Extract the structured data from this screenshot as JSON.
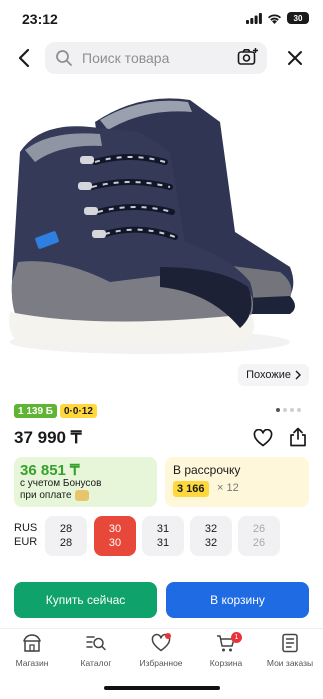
{
  "status_bar": {
    "time": "23:12",
    "battery": "30"
  },
  "search": {
    "placeholder": "Поиск товара"
  },
  "similar": {
    "label": "Похожие"
  },
  "badges": {
    "bonus": "1 139 Б",
    "installment": "0·0·12"
  },
  "price": {
    "current": "37 990 ₸"
  },
  "bonus_card": {
    "price": "36 851 ₸",
    "line1": "с учетом Бонусов",
    "line2": "при оплате"
  },
  "installment_card": {
    "title": "В рассрочку",
    "amount": "3 166",
    "times": "× 12"
  },
  "sizes": {
    "row_labels": [
      "RUS",
      "EUR"
    ],
    "items": [
      {
        "rus": "28",
        "eur": "28",
        "state": "available"
      },
      {
        "rus": "30",
        "eur": "30",
        "state": "selected"
      },
      {
        "rus": "31",
        "eur": "31",
        "state": "available"
      },
      {
        "rus": "32",
        "eur": "32",
        "state": "available"
      },
      {
        "rus": "26",
        "eur": "26",
        "state": "disabled"
      }
    ]
  },
  "actions": {
    "buy_now": "Купить сейчас",
    "add_to_cart": "В корзину"
  },
  "tabs": [
    {
      "label": "Магазин",
      "icon": "shop-icon"
    },
    {
      "label": "Каталог",
      "icon": "catalog-search-icon"
    },
    {
      "label": "Избранное",
      "icon": "heart-icon"
    },
    {
      "label": "Корзина",
      "icon": "cart-icon",
      "badge": "1"
    },
    {
      "label": "Мои заказы",
      "icon": "orders-icon"
    }
  ],
  "colors": {
    "green": "#0fa36b",
    "blue": "#1e6be3",
    "red": "#e8483a",
    "yellow": "#ffd83d"
  }
}
